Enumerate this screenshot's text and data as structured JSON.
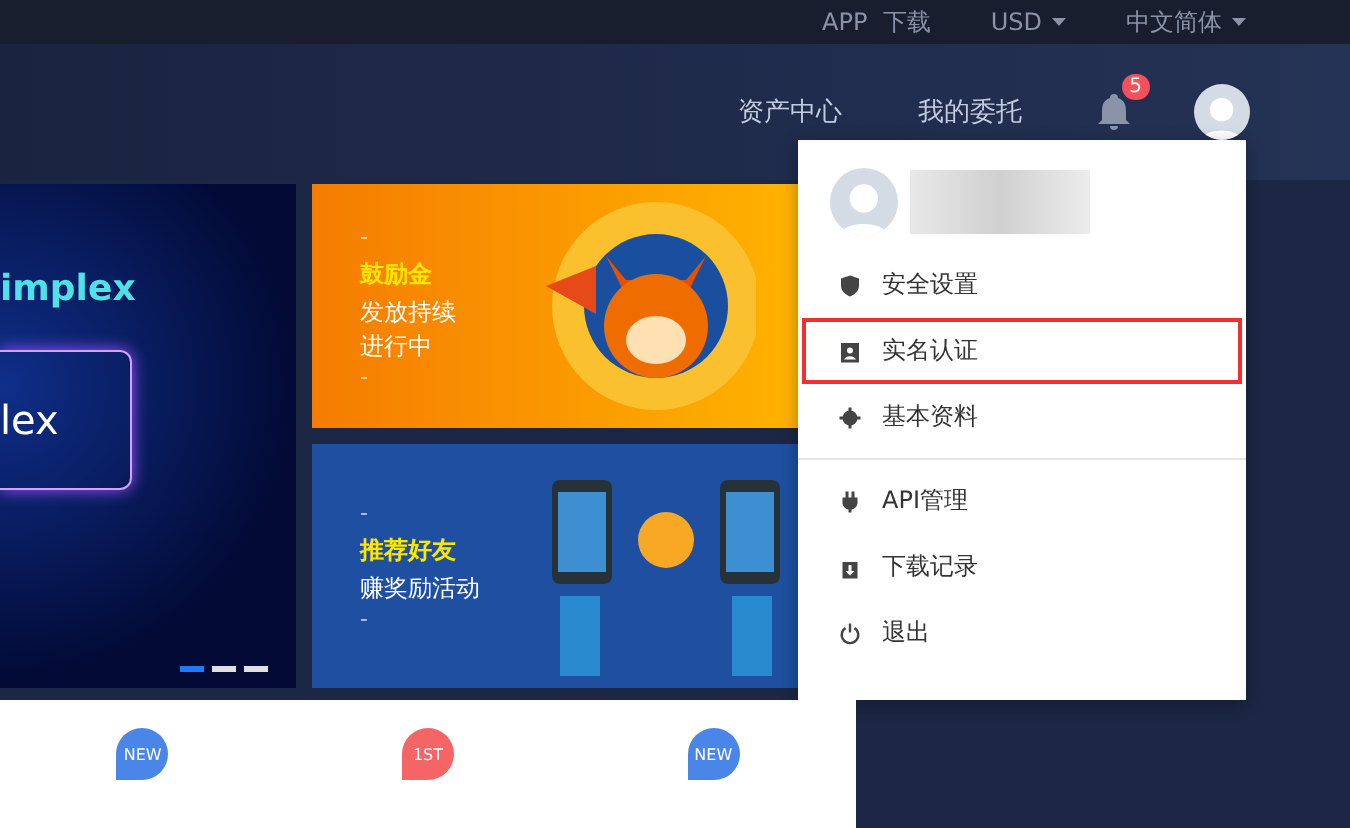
{
  "top_bar": {
    "links": [
      {
        "label": "APP  下载",
        "kind": "link"
      },
      {
        "label": "USD",
        "kind": "dropdown"
      },
      {
        "label": "中文简体",
        "kind": "dropdown"
      }
    ]
  },
  "nav": {
    "items": [
      "资产中心",
      "我的委托"
    ],
    "notification_count": "5"
  },
  "banners": {
    "main": {
      "title": "implex",
      "button": "lex",
      "dots": [
        {
          "selected": true
        },
        {
          "selected": false
        },
        {
          "selected": false
        }
      ]
    },
    "promos": [
      {
        "kind": "fox",
        "dash_top": "-",
        "highlight": "鼓励金",
        "lines": [
          "发放持续",
          "进行中"
        ],
        "dash_bottom": "-"
      },
      {
        "kind": "phones",
        "dash_top": "-",
        "highlight": "推荐好友",
        "lines": [
          "赚奖励活动"
        ],
        "dash_bottom": "-"
      }
    ]
  },
  "user_menu": {
    "groups": [
      {
        "items": [
          {
            "label": "安全设置",
            "highlighted": false
          },
          {
            "label": "实名认证",
            "highlighted": true
          },
          {
            "label": "基本资料",
            "highlighted": false
          }
        ]
      },
      {
        "items": [
          {
            "label": "API管理",
            "highlighted": false
          },
          {
            "label": "下载记录",
            "highlighted": false
          },
          {
            "label": "退出",
            "highlighted": false
          }
        ]
      }
    ]
  },
  "coin_badges": [
    {
      "label": "NEW",
      "color": "#4a86e8"
    },
    {
      "label": "1ST",
      "color": "#f56565"
    },
    {
      "label": "NEW",
      "color": "#4a86e8"
    }
  ]
}
